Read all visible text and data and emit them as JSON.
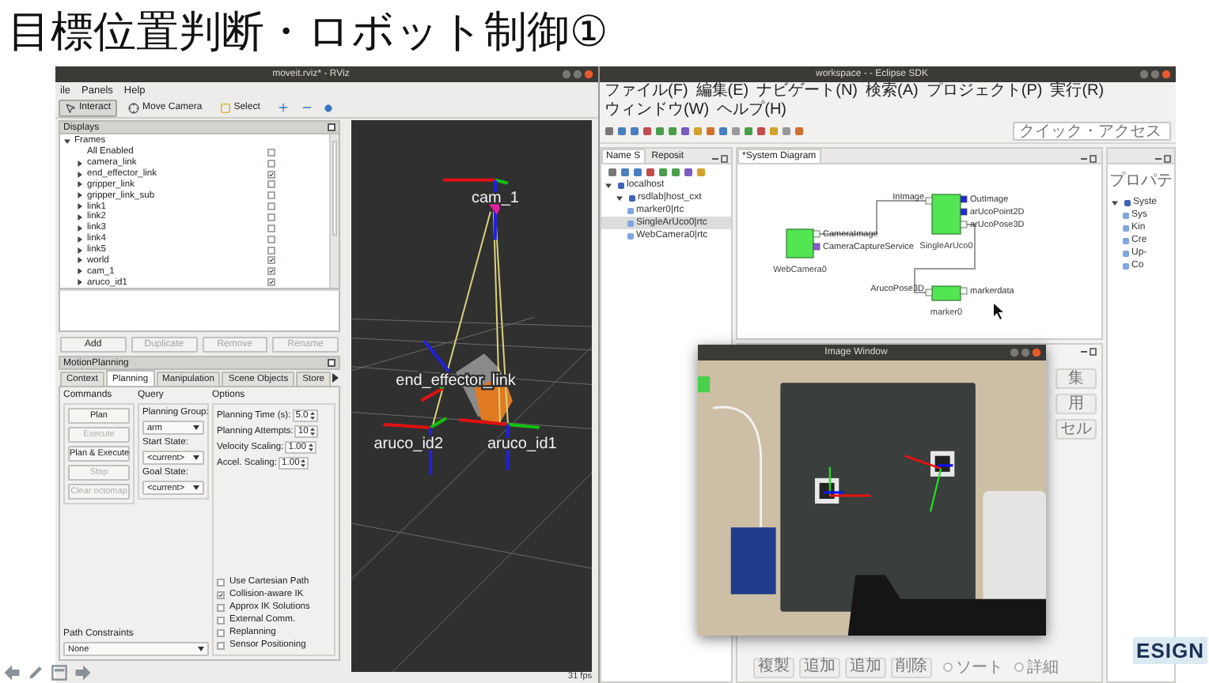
{
  "slide": {
    "title": "目標位置判断・ロボット制御①",
    "logo": "ESIGN"
  },
  "rviz": {
    "title": "moveit.rviz* - RViz",
    "menu": [
      "ile",
      "Panels",
      "Help"
    ],
    "tools": [
      {
        "label": "Interact",
        "selected": true
      },
      {
        "label": "Move Camera",
        "selected": false
      },
      {
        "label": "Select",
        "selected": false
      }
    ],
    "displays": {
      "title": "Displays",
      "tree": [
        {
          "label": "Frames",
          "expanded": true,
          "children": [
            {
              "label": "All Enabled",
              "checked": false
            },
            {
              "label": "camera_link",
              "checked": false,
              "expanded": false
            },
            {
              "label": "end_effector_link",
              "checked": true,
              "expanded": false
            },
            {
              "label": "gripper_link",
              "checked": false,
              "expanded": false
            },
            {
              "label": "gripper_link_sub",
              "checked": false,
              "expanded": false
            },
            {
              "label": "link1",
              "checked": false,
              "expanded": false
            },
            {
              "label": "link2",
              "checked": false,
              "expanded": false
            },
            {
              "label": "link3",
              "checked": false,
              "expanded": false
            },
            {
              "label": "link4",
              "checked": false,
              "expanded": false
            },
            {
              "label": "link5",
              "checked": false,
              "expanded": false
            },
            {
              "label": "world",
              "checked": true,
              "expanded": false
            },
            {
              "label": "cam_1",
              "checked": true,
              "expanded": false
            },
            {
              "label": "aruco_id1",
              "checked": true,
              "expanded": false
            }
          ]
        }
      ]
    },
    "display_buttons": [
      {
        "label": "Add",
        "disabled": false
      },
      {
        "label": "Duplicate",
        "disabled": true
      },
      {
        "label": "Remove",
        "disabled": true
      },
      {
        "label": "Rename",
        "disabled": true
      }
    ],
    "motion_planning": {
      "title": "MotionPlanning",
      "tabs": [
        {
          "label": "Context",
          "selected": false
        },
        {
          "label": "Planning",
          "selected": true
        },
        {
          "label": "Manipulation",
          "selected": false
        },
        {
          "label": "Scene Objects",
          "selected": false
        },
        {
          "label": "Store",
          "selected": false
        }
      ],
      "commands_title": "Commands",
      "commands": [
        {
          "label": "Plan",
          "disabled": false
        },
        {
          "label": "Execute",
          "disabled": true
        },
        {
          "label": "Plan & Execute",
          "disabled": false
        },
        {
          "label": "Stop",
          "disabled": true
        },
        {
          "label": "Clear octomap",
          "disabled": true
        }
      ],
      "query_title": "Query",
      "query": [
        {
          "label": "Planning Group:",
          "value": "arm"
        },
        {
          "label": "Start State:",
          "value": "<current>"
        },
        {
          "label": "Goal State:",
          "value": "<current>"
        }
      ],
      "options_title": "Options",
      "spinners": [
        {
          "label": "Planning Time (s):",
          "value": "5.0"
        },
        {
          "label": "Planning Attempts:",
          "value": "10"
        },
        {
          "label": "Velocity Scaling:",
          "value": "1.00"
        },
        {
          "label": "Accel. Scaling:",
          "value": "1.00"
        }
      ],
      "checkboxes": [
        {
          "label": "Use Cartesian Path",
          "checked": false
        },
        {
          "label": "Collision-aware IK",
          "checked": true
        },
        {
          "label": "Approx IK Solutions",
          "checked": false
        },
        {
          "label": "External Comm.",
          "checked": false
        },
        {
          "label": "Replanning",
          "checked": false
        },
        {
          "label": "Sensor Positioning",
          "checked": false
        }
      ],
      "path_constraints": {
        "label": "Path Constraints",
        "value": "None"
      }
    },
    "view": {
      "labels": [
        "cam_1",
        "end_effector_link",
        "aruco_id2",
        "aruco_id1"
      ],
      "fps": "31 fps"
    }
  },
  "eclipse": {
    "title": "workspace - - Eclipse SDK",
    "menu": [
      "ファイル(F)",
      "編集(E)",
      "ナビゲート(N)",
      "検索(A)",
      "プロジェクト(P)",
      "実行(R)",
      "ウィンドウ(W)",
      "ヘルプ(H)"
    ],
    "quick_access": {
      "placeholder": "クイック・アクセス"
    },
    "left_tabs": [
      {
        "label": "Name S",
        "selected": true
      },
      {
        "label": "Reposit",
        "selected": false
      }
    ],
    "tree": [
      {
        "label": "localhost",
        "expanded": true,
        "children": [
          {
            "label": "rsdlab|host_cxt",
            "expanded": true,
            "children": [
              {
                "label": "marker0|rtc",
                "selected": false
              },
              {
                "label": "SingleArUco0|rtc",
                "selected": true
              },
              {
                "label": "WebCamera0|rtc",
                "selected": false
              }
            ]
          }
        ]
      }
    ],
    "editor_tab": "*System Diagram",
    "diagram": {
      "components": [
        {
          "name": "WebCamera0",
          "ports": [
            {
              "label": "CameraImage",
              "kind": "out",
              "connected": true
            },
            {
              "label": "CameraCaptureService",
              "kind": "service"
            }
          ]
        },
        {
          "name": "SingleArUco0",
          "ports": [
            {
              "label": "InImage",
              "kind": "in",
              "connected": true
            },
            {
              "label": "OutImage",
              "kind": "out",
              "connected": false
            },
            {
              "label": "arUcoPoint2D",
              "kind": "out",
              "connected": false
            },
            {
              "label": "arUcoPose3D",
              "kind": "out",
              "connected": true
            }
          ]
        },
        {
          "name": "marker0",
          "ports": [
            {
              "label": "ArucoPose3D",
              "kind": "in",
              "connected": true
            },
            {
              "label": "markerdata",
              "kind": "out",
              "connected": true
            }
          ]
        }
      ]
    },
    "properties": {
      "title": "プロパテ",
      "tree": [
        {
          "label": "Syste",
          "expanded": true,
          "children": [
            {
              "label": "Sys"
            },
            {
              "label": "Kin"
            },
            {
              "label": "Cre"
            },
            {
              "label": "Up-"
            },
            {
              "label": "Co"
            }
          ]
        }
      ]
    },
    "side_buttons": [
      "集",
      "用",
      "セル"
    ],
    "bottom_buttons": [
      {
        "label": "複製",
        "kind": "button"
      },
      {
        "label": "追加",
        "kind": "button"
      },
      {
        "label": "追加",
        "kind": "button"
      },
      {
        "label": "削除",
        "kind": "button"
      },
      {
        "label": "ソート",
        "kind": "radio",
        "selected": false
      },
      {
        "label": "詳細",
        "kind": "radio",
        "selected": false
      }
    ]
  },
  "image_window": {
    "title": "Image Window"
  }
}
